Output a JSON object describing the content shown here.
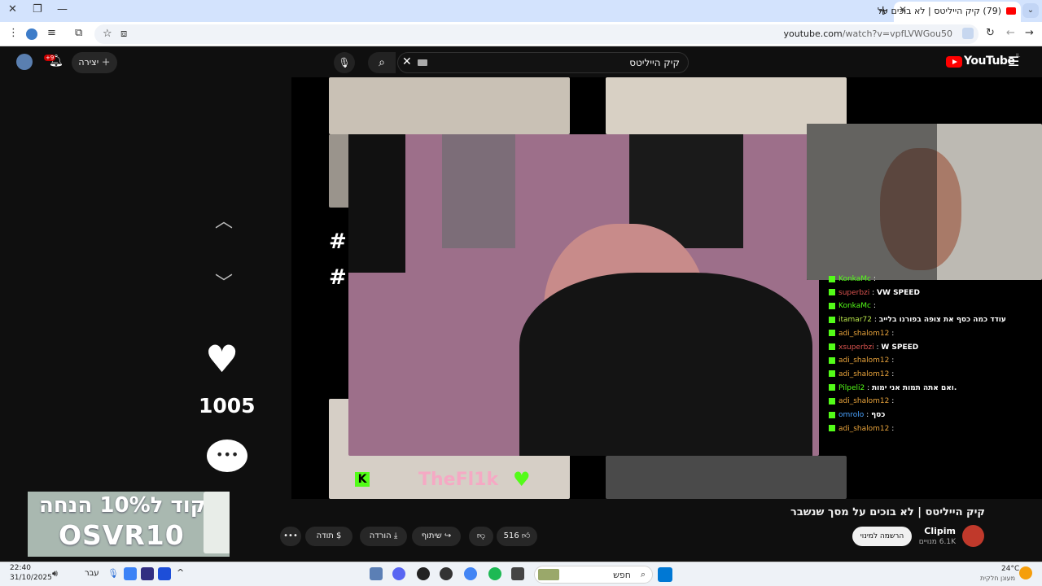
{
  "browser": {
    "tab_title": "(79) קיק הייליטס | לא בוכים על",
    "tab_close": "✕",
    "new_tab": "+",
    "url_host": "youtube.com",
    "url_path": "/watch?v=vpfLVWGou50"
  },
  "youtube": {
    "logo": "YouTube",
    "logo_sup": "IL",
    "search_value": "קיק הייליטס",
    "create_label": "יצירה",
    "notif_badge": "+9"
  },
  "video": {
    "likes_side": "1005",
    "title": "קיק הייליטס | לא בוכים על מסך שנשבר",
    "channel_name": "Clipim",
    "channel_subs": "6.1K מנויים",
    "subscribe_label": "הרשמה למינוי",
    "like_count": "516",
    "share_label": "שיתוף",
    "download_label": "הורדה",
    "thanks_label": "תודה",
    "overlay_name": "TheFl1k"
  },
  "chat": [
    {
      "user": "KonkaMc",
      "msg": "",
      "color": "#53fc18"
    },
    {
      "user": "superbzi",
      "msg": "VW SPEED",
      "color": "#d9534f"
    },
    {
      "user": "KonkaMc",
      "msg": "",
      "color": "#53fc18"
    },
    {
      "user": "itamar72",
      "msg": "עודד כמה כסף את צופה בפורנו בלייב",
      "color": "#b7e34a"
    },
    {
      "user": "adi_shalom12",
      "msg": "",
      "color": "#e8a33b"
    },
    {
      "user": "xsuperbzi",
      "msg": "W SPEED",
      "color": "#d9534f"
    },
    {
      "user": "adi_shalom12",
      "msg": "",
      "color": "#e8a33b"
    },
    {
      "user": "adi_shalom12",
      "msg": "",
      "color": "#e8a33b"
    },
    {
      "user": "Pilpeli2",
      "msg": "ואם אתה תמות אני ימות.",
      "color": "#53fc18"
    },
    {
      "user": "adi_shalom12",
      "msg": "",
      "color": "#e8a33b"
    },
    {
      "user": "omrolo",
      "msg": "כסף",
      "color": "#4aa3ff"
    },
    {
      "user": "adi_shalom12",
      "msg": "",
      "color": "#e8a33b"
    }
  ],
  "ad": {
    "line1": "קוד ל10% הנחה",
    "line2": "OSVR10"
  },
  "taskbar": {
    "time": "22:40",
    "date": "31/10/2025",
    "lang": "עבר",
    "search_placeholder": "חפש",
    "weather_temp": "24°C",
    "weather_desc": "מעונן חלקית"
  },
  "colors": {
    "yt_red": "#ff0000",
    "kick_green": "#53fc18"
  }
}
